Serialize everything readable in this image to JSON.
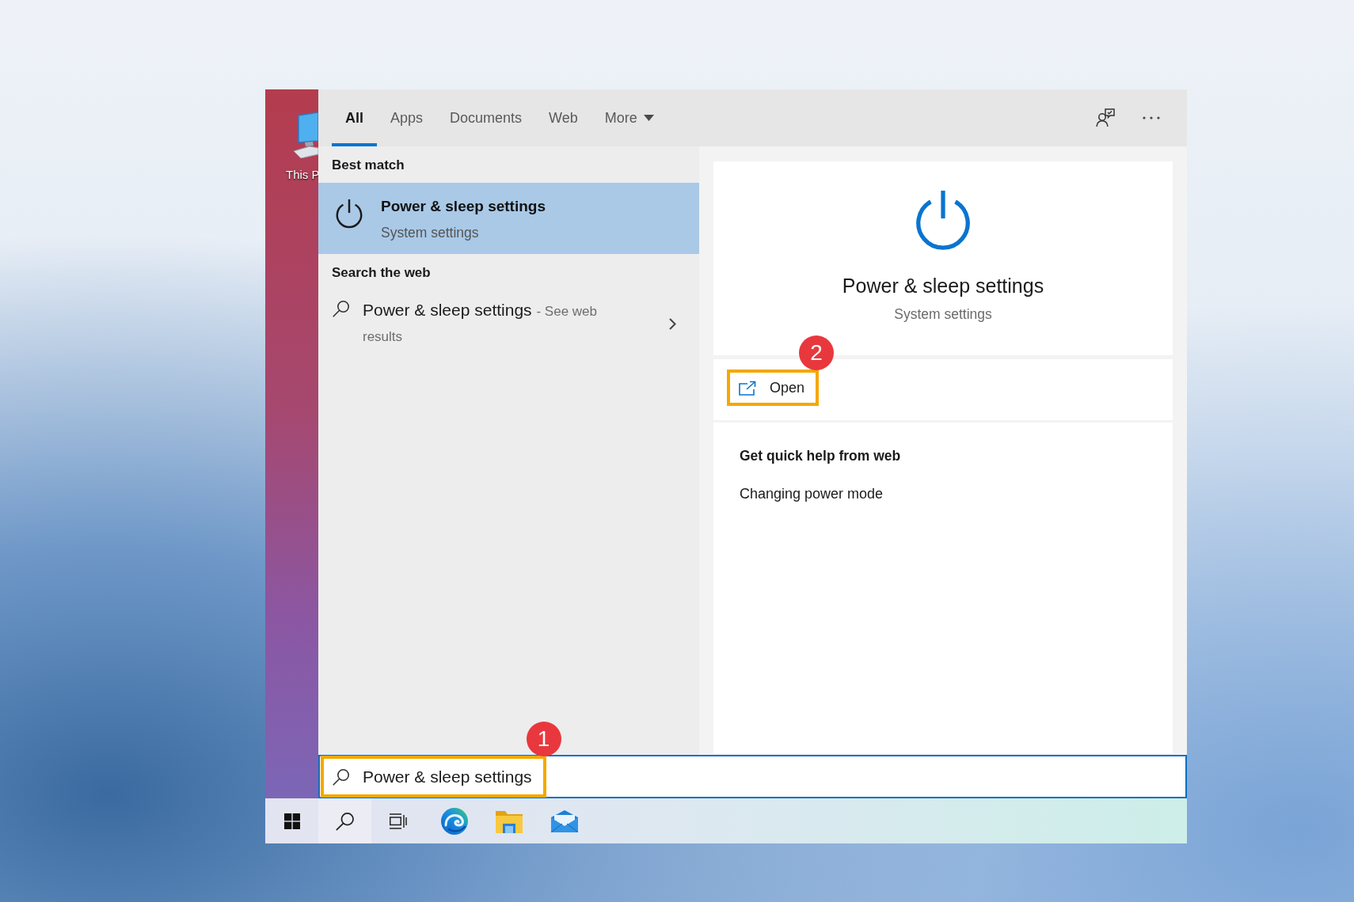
{
  "desktop": {
    "icon_label": "This P"
  },
  "tabs": [
    {
      "label": "All",
      "kind": "tab",
      "selected": true
    },
    {
      "label": "Apps",
      "kind": "tab",
      "selected": false
    },
    {
      "label": "Documents",
      "kind": "tab",
      "selected": false
    },
    {
      "label": "Web",
      "kind": "tab",
      "selected": false
    },
    {
      "label": "More",
      "kind": "dropdown",
      "selected": false
    }
  ],
  "results": [
    {
      "heading": "Best match",
      "items": [
        {
          "kind": "app",
          "title": "Power & sleep settings",
          "subtitle": "System settings",
          "selected": true
        }
      ]
    },
    {
      "heading": "Search the web",
      "items": [
        {
          "kind": "web",
          "title": "Power & sleep settings",
          "suffix": "- See web results",
          "selected": false
        }
      ]
    }
  ],
  "preview": {
    "title": "Power & sleep settings",
    "subtitle": "System settings",
    "actions": [
      {
        "label": "Open",
        "highlighted": true,
        "step_badge": "2"
      }
    ],
    "help": {
      "heading": "Get quick help from web",
      "links": [
        "Changing power mode"
      ]
    }
  },
  "search_box": {
    "value": "Power & sleep settings",
    "highlighted": true,
    "step_badge": "1"
  }
}
